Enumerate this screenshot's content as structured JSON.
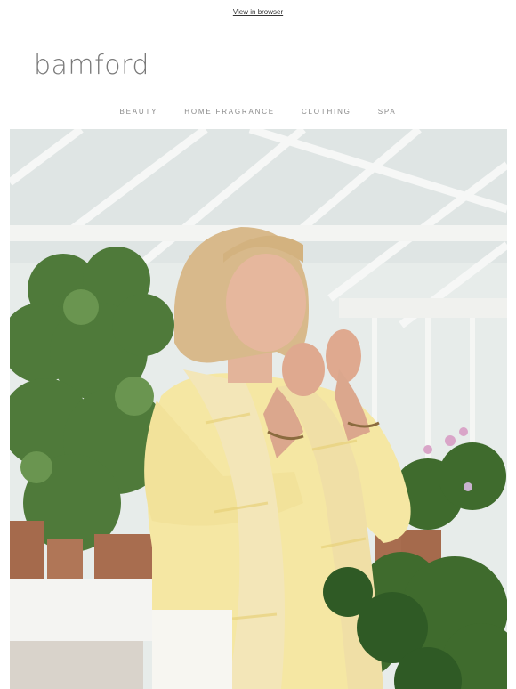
{
  "header": {
    "view_in_browser": "View in browser",
    "logo_text": "bamford"
  },
  "nav": {
    "items": [
      {
        "label": "BEAUTY"
      },
      {
        "label": "HOME FRAGRANCE"
      },
      {
        "label": "CLOTHING"
      },
      {
        "label": "SPA"
      }
    ]
  },
  "hero": {
    "image": "woman-smelling-flowers-greenhouse-photo",
    "colors": {
      "cardigan": "#f5e7a3",
      "scarf": "#f3e6b8",
      "foliage": "#4f7a3a",
      "glass": "#dfe6e5"
    }
  }
}
